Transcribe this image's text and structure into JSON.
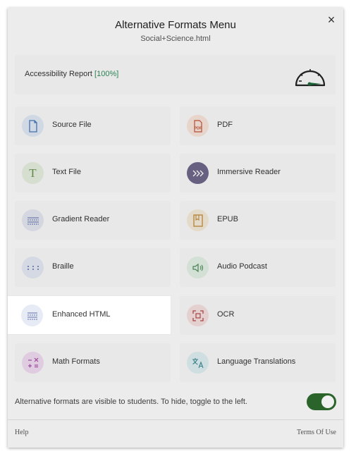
{
  "modal": {
    "title": "Alternative Formats Menu",
    "subtitle": "Social+Science.html",
    "close_icon": "×"
  },
  "report": {
    "label": "Accessibility Report",
    "percent": "[100%]",
    "gauge_icon": "speedometer-icon"
  },
  "formats": [
    {
      "label": "Source File",
      "icon": "file-icon",
      "color": "#dde6f2",
      "icon_color": "#4a78b5"
    },
    {
      "label": "PDF",
      "icon": "pdf-icon",
      "color": "#f6e2d8",
      "icon_color": "#c0533a"
    },
    {
      "label": "Text File",
      "icon": "text-t-icon",
      "color": "#e4eddc",
      "icon_color": "#6a8f52"
    },
    {
      "label": "Immersive Reader",
      "icon": "immersive-reader-icon",
      "color": "#6e6788",
      "icon_color": "#ffffff"
    },
    {
      "label": "Gradient Reader",
      "icon": "gradient-lines-icon",
      "color": "#e2e4ee",
      "icon_color": "#5b6ea5"
    },
    {
      "label": "EPUB",
      "icon": "book-icon",
      "color": "#f3e8d6",
      "icon_color": "#c08a3e"
    },
    {
      "label": "Braille",
      "icon": "braille-dots-icon",
      "color": "#e2e7f3",
      "icon_color": "#5b6ea5"
    },
    {
      "label": "Audio Podcast",
      "icon": "speaker-icon",
      "color": "#e1eee3",
      "icon_color": "#4f8a5c"
    },
    {
      "label": "Enhanced HTML",
      "icon": "enhanced-lines-icon",
      "color": "#e7ebf6",
      "icon_color": "#5b6ea5"
    },
    {
      "label": "OCR",
      "icon": "ocr-scan-icon",
      "color": "#f4dddd",
      "icon_color": "#b04a4a"
    },
    {
      "label": "Math Formats",
      "icon": "math-symbols-icon",
      "color": "#efd9ef",
      "icon_color": "#a44fa4"
    },
    {
      "label": "Language Translations",
      "icon": "translate-icon",
      "color": "#dcecef",
      "icon_color": "#3f8a93"
    }
  ],
  "selected_format": "Enhanced HTML",
  "visibility": {
    "text": "Alternative formats are visible to students. To hide, toggle to the left.",
    "toggle_on": true
  },
  "footer": {
    "help": "Help",
    "terms": "Terms Of Use"
  },
  "colors": {
    "accent_green": "#2e6b2e",
    "percent_green": "#2e8b57"
  }
}
